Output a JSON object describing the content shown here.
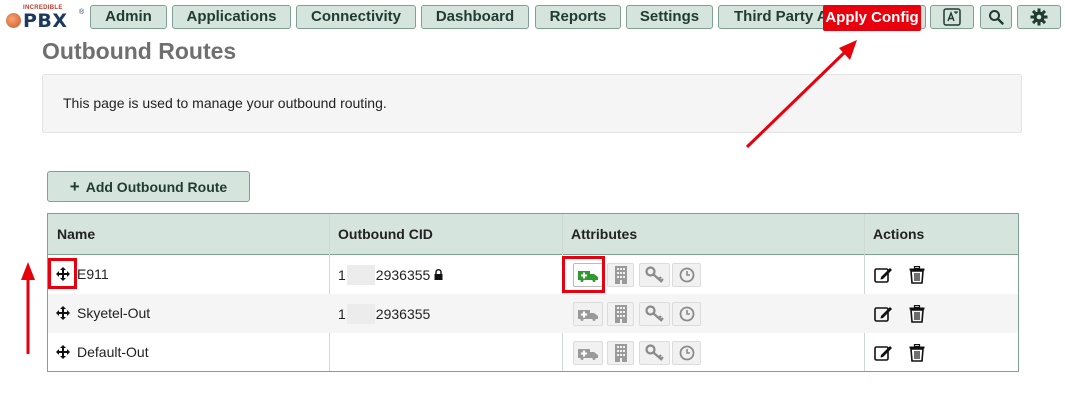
{
  "brand": {
    "small": "INCREDIBLE",
    "big": "PBX",
    "reg": "®"
  },
  "nav": {
    "admin": "Admin",
    "applications": "Applications",
    "connectivity": "Connectivity",
    "dashboard": "Dashboard",
    "reports": "Reports",
    "settings": "Settings",
    "third_party": "Third Party A",
    "apply_config": "Apply Config"
  },
  "page": {
    "title": "Outbound Routes",
    "description": "This page is used to manage your outbound routing."
  },
  "add_button": {
    "plus": "+",
    "label": "Add Outbound Route"
  },
  "table": {
    "headers": {
      "name": "Name",
      "cid": "Outbound CID",
      "attributes": "Attributes",
      "actions": "Actions"
    },
    "rows": [
      {
        "name": "E911",
        "cid_prefix": "1",
        "cid_suffix": "2936355",
        "locked": true,
        "emergency_active": true
      },
      {
        "name": "Skyetel-Out",
        "cid_prefix": "1",
        "cid_suffix": "2936355",
        "locked": false,
        "emergency_active": false
      },
      {
        "name": "Default-Out",
        "cid_prefix": "",
        "cid_suffix": "",
        "locked": false,
        "emergency_active": false
      }
    ]
  },
  "icons": {
    "top": [
      "translate-icon",
      "search-icon",
      "gear-icon"
    ],
    "attributes": [
      "emergency-icon",
      "building-icon",
      "key-icon",
      "clock-icon"
    ],
    "actions": [
      "edit-icon",
      "trash-icon"
    ],
    "row": "move-icon"
  },
  "colors": {
    "accent": "#d5e4dd",
    "border": "#7fa193",
    "highlight": "#e8000d",
    "emergency": "#2e9a2e"
  }
}
